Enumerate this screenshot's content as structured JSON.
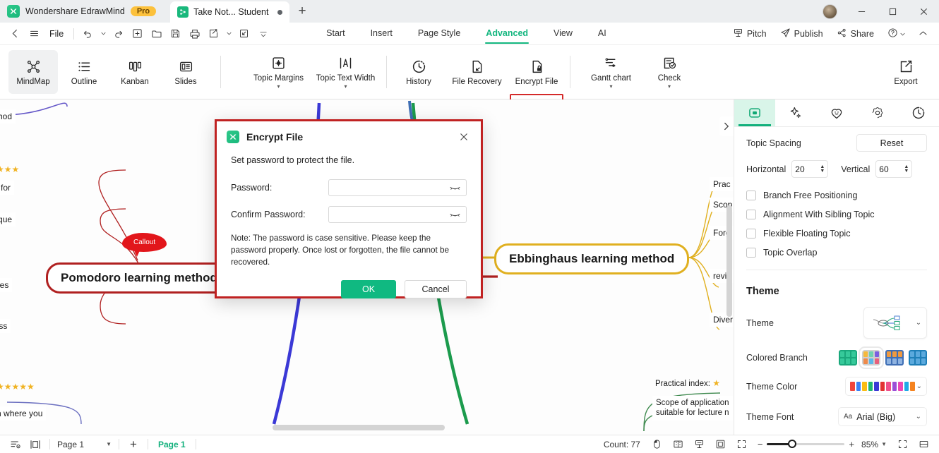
{
  "titlebar": {
    "app_name": "Wondershare EdrawMind",
    "pro_badge": "Pro",
    "doc_tab": "Take Not... Student",
    "new_tab": "+",
    "minimize": "—",
    "maximize": "☐",
    "close": "✕"
  },
  "menubar": {
    "back": "‹",
    "hamburger": "☰",
    "file": "File",
    "undo": "undo-icon",
    "redo": "redo-icon",
    "new": "new-icon",
    "open": "open-icon",
    "save": "save-icon",
    "print": "print-icon",
    "export_share": "export-icon",
    "import": "import-icon",
    "more": "more-icon",
    "tabs": [
      {
        "label": "Start",
        "active": false
      },
      {
        "label": "Insert",
        "active": false
      },
      {
        "label": "Page Style",
        "active": false
      },
      {
        "label": "Advanced",
        "active": true
      },
      {
        "label": "View",
        "active": false
      },
      {
        "label": "AI",
        "active": false
      }
    ],
    "right_items": [
      {
        "label": "Pitch",
        "icon": "pitch-icon"
      },
      {
        "label": "Publish",
        "icon": "publish-icon"
      },
      {
        "label": "Share",
        "icon": "share-icon"
      }
    ],
    "help": "?",
    "collapse_ribbon": "⌃"
  },
  "ribbon": {
    "views": [
      {
        "label": "MindMap",
        "selected": true
      },
      {
        "label": "Outline",
        "selected": false
      },
      {
        "label": "Kanban",
        "selected": false
      },
      {
        "label": "Slides",
        "selected": false
      }
    ],
    "tools": [
      {
        "label": "Topic Margins",
        "has_caret": true
      },
      {
        "label": "Topic Text Width",
        "has_caret": true
      },
      {
        "label": "History",
        "has_caret": false
      },
      {
        "label": "File Recovery",
        "has_caret": false
      },
      {
        "label": "Encrypt File",
        "has_caret": false,
        "highlighted": true
      },
      {
        "label": "Gantt chart",
        "has_caret": true
      },
      {
        "label": "Check",
        "has_caret": true
      }
    ],
    "export": "Export"
  },
  "canvas": {
    "nodes": [
      {
        "text": "Pomodoro learning method",
        "type": "center-red"
      },
      {
        "text": "Ebbinghaus learning method",
        "type": "center-yellow"
      },
      {
        "text": "Callout",
        "type": "callout"
      }
    ],
    "clipped_labels": [
      "method",
      "able for",
      "chnique",
      "nciples",
      "rocess",
      "casion where you",
      "Prac",
      "Scop",
      "Forg",
      "revie",
      "Diver",
      "Practical index:",
      "Scope of application",
      "suitable for lecture n"
    ],
    "star_ratings": [
      "★★★",
      "★★★★★",
      "★"
    ],
    "colors": {
      "red_branch": "#b02020",
      "yellow_branch": "#e0b020",
      "blue_branch": "#3b39d6",
      "green_branch": "#1c9b4d",
      "purple_branch": "#6659c9",
      "steel_branch": "#3f6fb5"
    }
  },
  "right_panel": {
    "tabs": [
      {
        "name": "layout-tab",
        "icon": "layout-icon",
        "active": true
      },
      {
        "name": "style-tab",
        "icon": "sparkle-icon",
        "active": false
      },
      {
        "name": "icon-tab",
        "icon": "smiley-icon",
        "active": false
      },
      {
        "name": "settings-tab",
        "icon": "gear-flower-icon",
        "active": false
      },
      {
        "name": "history-tab",
        "icon": "clock-icon",
        "active": false
      }
    ],
    "topic_spacing": {
      "label": "Topic Spacing",
      "reset": "Reset",
      "horizontal_label": "Horizontal",
      "horizontal_value": "20",
      "vertical_label": "Vertical",
      "vertical_value": "60"
    },
    "checkboxes": [
      {
        "label": "Branch Free Positioning",
        "checked": false
      },
      {
        "label": "Alignment With Sibling Topic",
        "checked": false
      },
      {
        "label": "Flexible Floating Topic",
        "checked": false
      },
      {
        "label": "Topic Overlap",
        "checked": false
      }
    ],
    "theme": {
      "title": "Theme",
      "theme_label": "Theme",
      "colored_branch_label": "Colored Branch",
      "theme_color_label": "Theme Color",
      "theme_font_label": "Theme Font",
      "theme_font_value": "Arial (Big)",
      "font_prefix": "Aa",
      "theme_color_swatches": [
        "#f0453c",
        "#3b82f6",
        "#fbbc12",
        "#22b573",
        "#3b39d6",
        "#e23232",
        "#f04f8a",
        "#9b4fd6",
        "#ec46b6",
        "#1fa9e8",
        "#f5831f"
      ],
      "branch_selected_index": 1
    }
  },
  "dialog": {
    "title": "Encrypt File",
    "close": "✕",
    "subtitle": "Set password to protect the file.",
    "password_label": "Password:",
    "password_value": "",
    "confirm_label": "Confirm Password:",
    "confirm_value": "",
    "note": "Note: The password is case sensitive. Please keep the password properly. Once lost or forgotten, the file cannot be recovered.",
    "ok": "OK",
    "cancel": "Cancel"
  },
  "statusbar": {
    "outline_icon": "outline-icon",
    "pane_icon": "pane-icon",
    "page_select": "Page 1",
    "add_page": "+",
    "active_page": "Page 1",
    "count": "Count: 77",
    "zoom_value": "85%",
    "zoom_minus": "−",
    "zoom_plus": "+"
  }
}
